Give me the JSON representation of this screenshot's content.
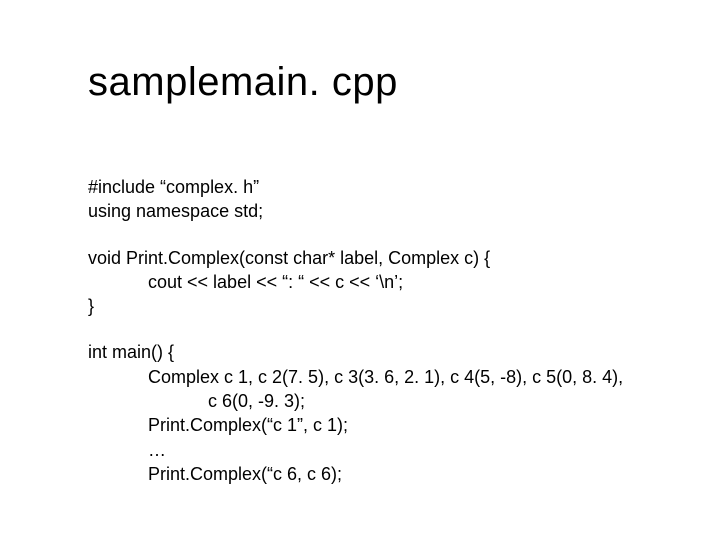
{
  "title": "samplemain. cpp",
  "intro": {
    "include": "#include “complex. h”",
    "using": "using namespace std;"
  },
  "func": {
    "sig": "void Print.Complex(const char* label, Complex c) {",
    "body": "cout << label << “: “ << c << ‘\\n’;",
    "close": "}"
  },
  "main": {
    "open": "int main() {",
    "decl1": "Complex c 1, c 2(7. 5), c 3(3. 6, 2. 1), c 4(5, -8), c 5(0, 8. 4),",
    "decl2": "c 6(0, -9. 3);",
    "call1": "Print.Complex(“c 1”, c 1);",
    "ellipsis": "…",
    "call2": "Print.Complex(“c 6, c 6);"
  }
}
